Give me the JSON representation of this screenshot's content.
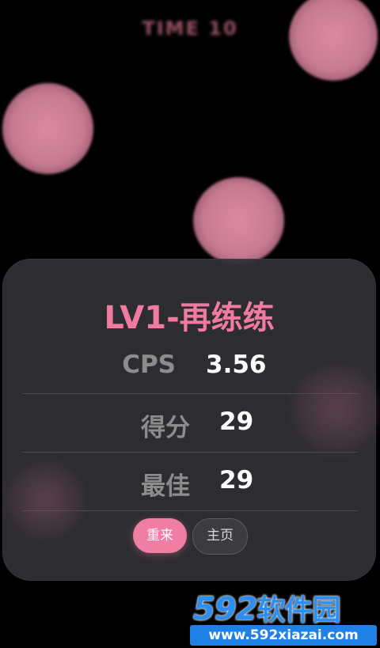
{
  "timer": {
    "text": "TIME 10"
  },
  "result": {
    "title": "LV1-再练练",
    "stats": [
      {
        "label": "CPS",
        "value": "3.56"
      },
      {
        "label": "得分",
        "value": "29"
      },
      {
        "label": "最佳",
        "value": "29"
      }
    ],
    "buttons": {
      "retry": "重来",
      "home": "主页"
    }
  },
  "watermark": {
    "brand_number": "592",
    "brand_text": "软件园",
    "url": "www.592xiazai.com"
  },
  "colors": {
    "background": "#000000",
    "accent": "#f07aa0",
    "bubble": "#c77b92",
    "panel": "#303034",
    "label": "#8c8c8c",
    "value": "#ffffff",
    "watermark": "#2a8ff0"
  }
}
